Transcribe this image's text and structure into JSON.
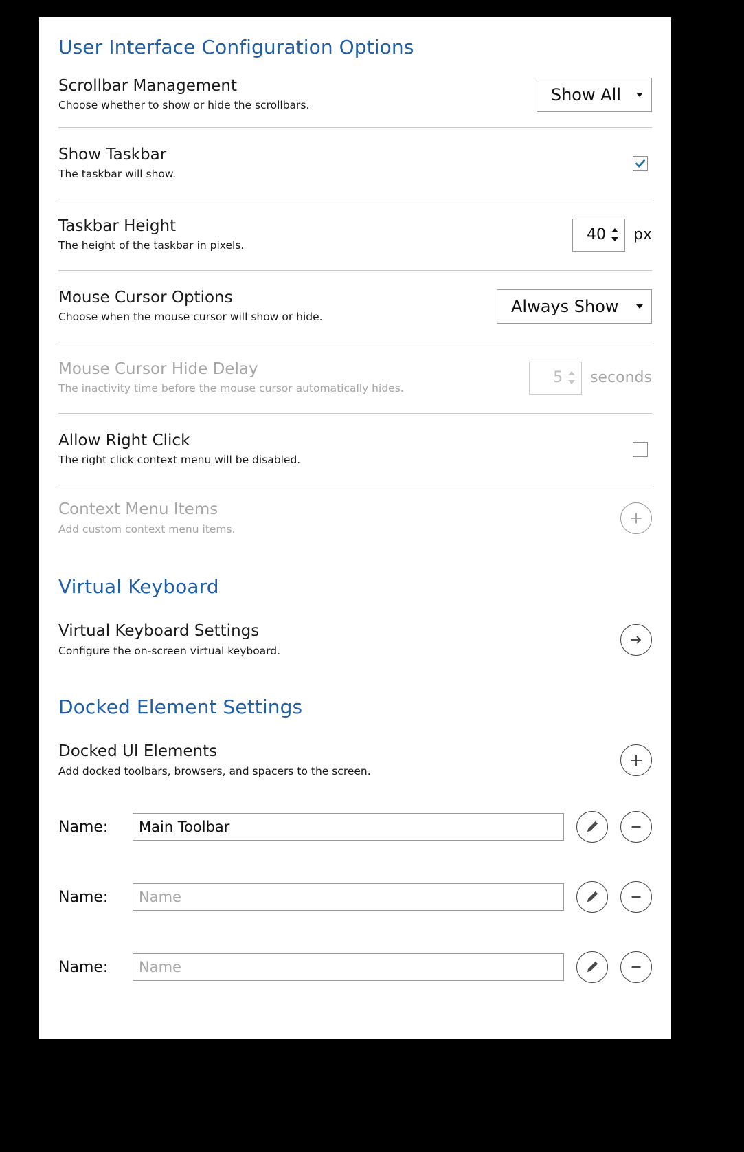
{
  "sections": {
    "ui_config": {
      "heading": "User Interface Configuration Options"
    },
    "virtual_keyboard": {
      "heading": "Virtual Keyboard"
    },
    "docked": {
      "heading": "Docked Element Settings"
    }
  },
  "rows": {
    "scrollbar": {
      "title": "Scrollbar Management",
      "desc": "Choose whether to show or hide the scrollbars.",
      "value": "Show All"
    },
    "show_taskbar": {
      "title": "Show Taskbar",
      "desc": "The taskbar will show.",
      "checked": true
    },
    "taskbar_height": {
      "title": "Taskbar Height",
      "desc": "The height of the taskbar in pixels.",
      "value": "40",
      "unit": "px"
    },
    "mouse_cursor": {
      "title": "Mouse Cursor Options",
      "desc": "Choose when the mouse cursor will show or hide.",
      "value": "Always Show"
    },
    "cursor_hide_delay": {
      "title": "Mouse Cursor Hide Delay",
      "desc": "The inactivity time before the mouse cursor automatically hides.",
      "value": "5",
      "unit": "seconds",
      "disabled": true
    },
    "allow_right_click": {
      "title": "Allow Right Click",
      "desc": "The right click context menu will be disabled.",
      "checked": false
    },
    "context_menu_items": {
      "title": "Context Menu Items",
      "desc": "Add custom context menu items.",
      "disabled": true
    },
    "vk_settings": {
      "title": "Virtual Keyboard Settings",
      "desc": "Configure the on-screen virtual keyboard."
    },
    "docked_elements": {
      "title": "Docked UI Elements",
      "desc": "Add docked toolbars, browsers, and spacers to the screen."
    }
  },
  "docked_items": [
    {
      "label": "Name:",
      "value": "Main Toolbar",
      "placeholder": "Name"
    },
    {
      "label": "Name:",
      "value": "",
      "placeholder": "Name"
    },
    {
      "label": "Name:",
      "value": "",
      "placeholder": "Name"
    }
  ],
  "colors": {
    "heading_blue": "#1f5fa9",
    "check_blue": "#1a6fa8",
    "border_gray": "#c8c8c8",
    "disabled_gray": "#a6a6a6"
  }
}
